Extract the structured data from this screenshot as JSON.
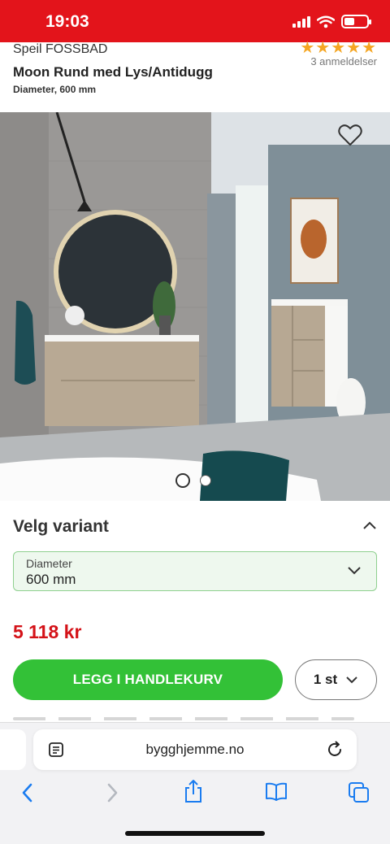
{
  "status": {
    "time": "19:03"
  },
  "product": {
    "brand": "Speil FOSSBAD",
    "title": "Moon Rund med Lys/Antidugg",
    "subtitle": "Diameter, 600 mm",
    "rating_stars": "★★★★★",
    "rating": 5,
    "reviews": "3 anmeldelser"
  },
  "variant": {
    "heading": "Velg variant",
    "field_label": "Diameter",
    "field_value": "600 mm"
  },
  "price": "5 118 kr",
  "cart": {
    "add_label": "LEGG I HANDLEKURV",
    "quantity": "1 st"
  },
  "gallery": {
    "image_count": 2,
    "active_index": 0
  },
  "browser": {
    "url": "bygghjemme.no"
  },
  "colors": {
    "brand_red": "#e3141b",
    "cta_green": "#33c137",
    "price_red": "#d41218",
    "star_gold": "#f5a623",
    "ios_blue": "#1a7cf0"
  },
  "icons": {
    "wishlist": "heart-icon",
    "collapse": "chevron-up-icon",
    "dropdown": "chevron-down-icon",
    "reader": "reader-icon",
    "reload": "reload-icon",
    "back": "back-icon",
    "forward": "forward-icon",
    "share": "share-icon",
    "bookmarks": "bookmarks-icon",
    "tabs": "tabs-icon"
  }
}
